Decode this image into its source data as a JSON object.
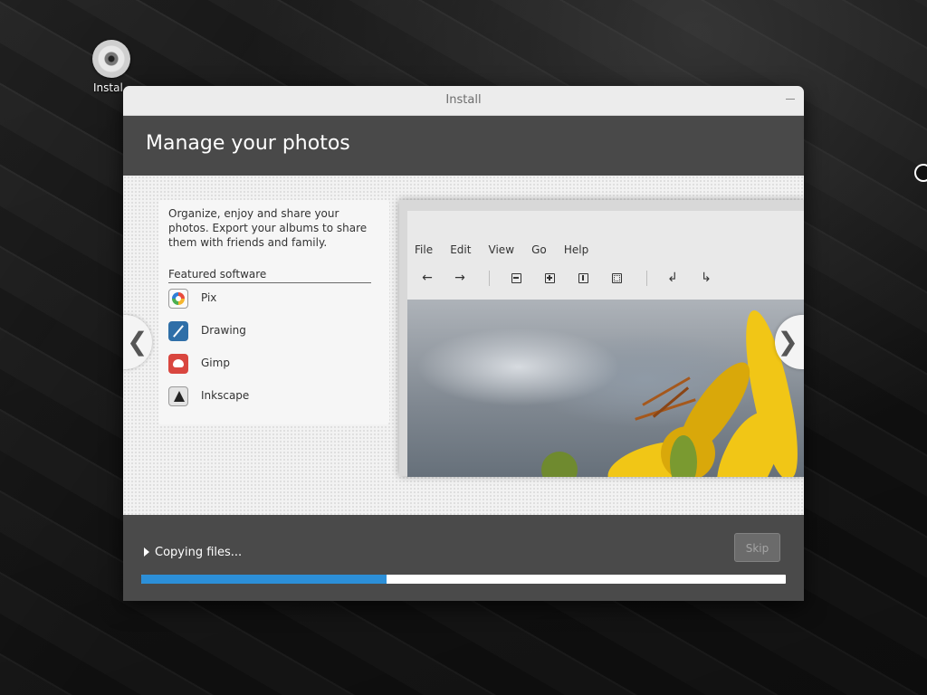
{
  "desktop": {
    "icon_label": "Instal"
  },
  "window": {
    "title": "Install",
    "header_title": "Manage your photos"
  },
  "slide": {
    "description": "Organize, enjoy and share your photos. Export your albums to share them with friends and family.",
    "featured_label": "Featured software",
    "apps": [
      {
        "name": "Pix",
        "icon": "pix-icon"
      },
      {
        "name": "Drawing",
        "icon": "drawing-icon"
      },
      {
        "name": "Gimp",
        "icon": "gimp-icon"
      },
      {
        "name": "Inkscape",
        "icon": "inkscape-icon"
      }
    ],
    "preview": {
      "menu": [
        "File",
        "Edit",
        "View",
        "Go",
        "Help"
      ],
      "toolbar_icons": [
        "back-arrow-icon",
        "forward-arrow-icon",
        "zoom-out-icon",
        "zoom-in-icon",
        "zoom-original-icon",
        "zoom-fit-icon",
        "rotate-left-icon",
        "rotate-right-icon"
      ]
    },
    "nav": {
      "prev_glyph": "❮",
      "next_glyph": "❯"
    }
  },
  "footer": {
    "status": "Copying files...",
    "skip_label": "Skip",
    "progress": 0.38
  },
  "colors": {
    "accent": "#2c8fd8",
    "window_bg": "#4a4a4a",
    "titlebar": "#ececec"
  }
}
